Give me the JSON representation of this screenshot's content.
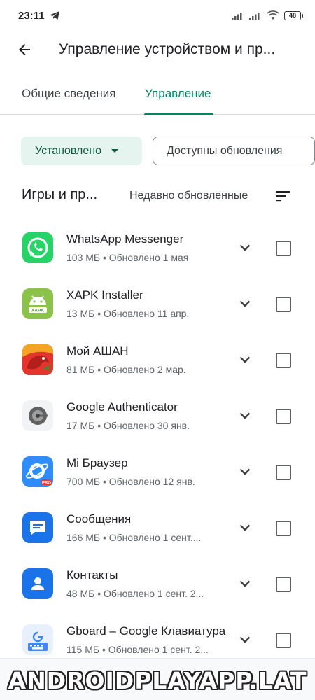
{
  "status_bar": {
    "time": "23:11",
    "battery": "48"
  },
  "header": {
    "title": "Управление устройством и пр..."
  },
  "tabs": [
    {
      "label": "Общие сведения",
      "active": false
    },
    {
      "label": "Управление",
      "active": true
    }
  ],
  "filters": {
    "installed_label": "Установлено",
    "updates_label": "Доступны обновления"
  },
  "section": {
    "title": "Игры и пр...",
    "sort_label": "Недавно обновленные"
  },
  "apps": [
    {
      "name": "WhatsApp Messenger",
      "meta": "103 МБ  •  Обновлено 1 мая",
      "icon": "whatsapp-icon"
    },
    {
      "name": "XAPK Installer",
      "meta": "13 МБ  •  Обновлено 11 апр.",
      "icon": "xapk-installer-icon",
      "icon_text": "XAPK"
    },
    {
      "name": "Мой АШАН",
      "meta": "81 МБ  •  Обновлено 2 мар.",
      "icon": "auchan-icon"
    },
    {
      "name": "Google Authenticator",
      "meta": "17 МБ  •  Обновлено 30 янв.",
      "icon": "authenticator-icon"
    },
    {
      "name": "Mi Браузер",
      "meta": "700 МБ  •  Обновлено 12 янв.",
      "icon": "mi-browser-icon",
      "icon_text": "PRO"
    },
    {
      "name": "Сообщения",
      "meta": "166 МБ  •  Обновлено 1 сент....",
      "icon": "messages-icon"
    },
    {
      "name": "Контакты",
      "meta": "48 МБ  •  Обновлено 1 сент. 2...",
      "icon": "contacts-icon"
    },
    {
      "name": "Gboard – Google Клавиатура",
      "meta": "115 МБ  •  Обновлено 1 сент. 2...",
      "icon": "gboard-icon"
    }
  ],
  "watermark": "ANDROIDPLAYAPP.LAT",
  "colors": {
    "accent": "#01875f",
    "chip_bg": "#e6f4ef"
  }
}
